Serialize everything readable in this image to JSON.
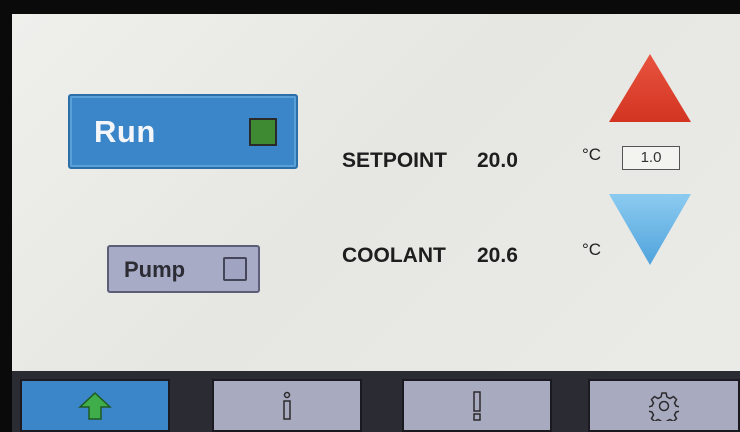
{
  "controls": {
    "run_label": "Run",
    "pump_label": "Pump"
  },
  "readouts": {
    "setpoint_label": "SETPOINT",
    "setpoint_value": "20.0",
    "setpoint_unit": "°C",
    "coolant_label": "COOLANT",
    "coolant_value": "20.6",
    "coolant_unit": "°C",
    "step_value": "1.0"
  },
  "icons": {
    "increase": "triangle-up-icon",
    "decrease": "triangle-down-icon",
    "home": "home-arrow-icon",
    "info": "info-icon",
    "alarm": "exclamation-icon",
    "settings": "gear-icon"
  },
  "colors": {
    "run_active": "#3a86c8",
    "run_led": "#3e8a33",
    "increase_arrow": "#e0412f",
    "decrease_arrow": "#6cb6e4",
    "home_nav_active": "#3a86c8",
    "nav_inactive": "#a8aac0"
  }
}
